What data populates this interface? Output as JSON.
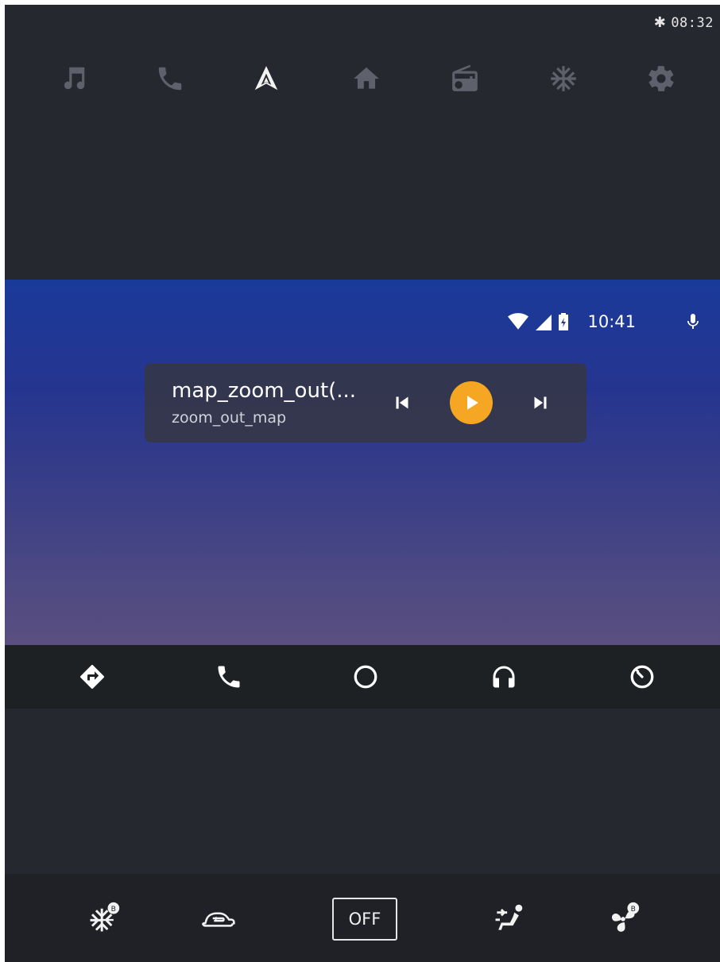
{
  "head_unit": {
    "status": {
      "bluetooth_icon": "bluetooth-icon",
      "time": "08:32"
    },
    "nav_icons": [
      "music-icon",
      "phone-icon",
      "android-auto-icon",
      "home-icon",
      "radio-icon",
      "climate-icon",
      "settings-icon"
    ]
  },
  "android_auto": {
    "status": {
      "time": "10:41",
      "icons": [
        "wifi-icon",
        "cell-signal-icon",
        "battery-icon",
        "microphone-icon"
      ]
    },
    "media": {
      "title": "map_zoom_out(...",
      "subtitle": "zoom_out_map",
      "accent": "#f5a623"
    },
    "nav_icons": [
      "navigation-icon",
      "phone-icon",
      "home-circle-icon",
      "headphones-icon",
      "recents-icon"
    ]
  },
  "climate_bar": {
    "off_label": "OFF",
    "icons": [
      "ac-snowflake-icon",
      "recirculation-icon",
      "off-button",
      "airflow-icon",
      "fan-icon"
    ]
  }
}
